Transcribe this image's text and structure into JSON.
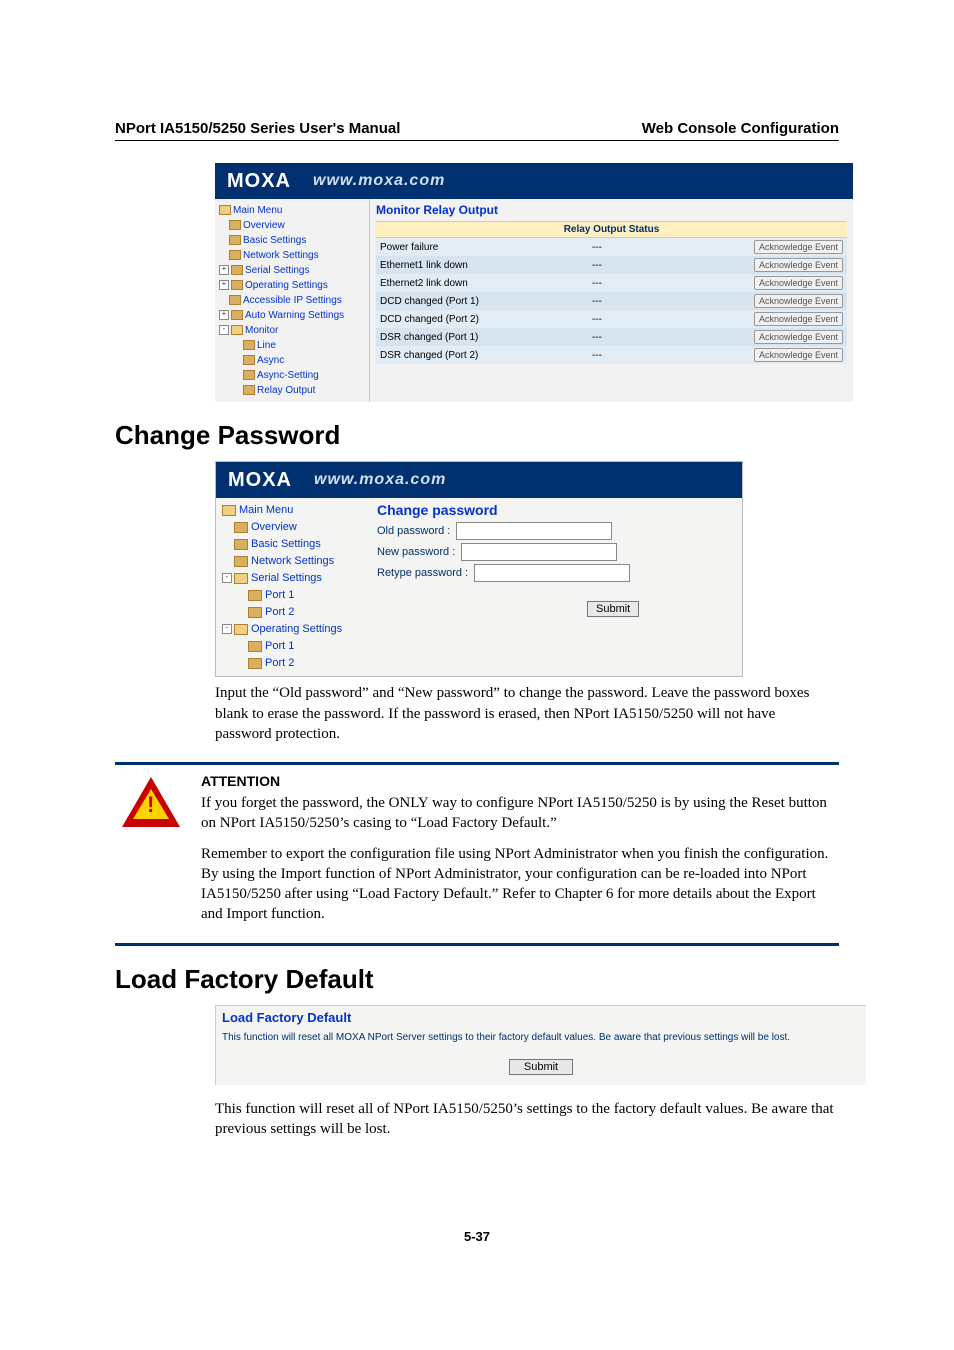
{
  "doc": {
    "header_left": "NPort IA5150/5250 Series User's Manual",
    "header_right": "Web Console Configuration",
    "page_num": "5-37"
  },
  "brand": {
    "logo": "MOXA",
    "url": "www.moxa.com"
  },
  "ss1": {
    "title": "Monitor Relay Output",
    "thead": "Relay Output Status",
    "tree": {
      "main": "Main Menu",
      "overview": "Overview",
      "basic": "Basic Settings",
      "network": "Network Settings",
      "serial": "Serial Settings",
      "operating": "Operating Settings",
      "accessible": "Accessible IP Settings",
      "autowarn": "Auto Warning Settings",
      "monitor": "Monitor",
      "line": "Line",
      "async": "Async",
      "asyncset": "Async-Setting",
      "relay": "Relay Output"
    },
    "rows": [
      {
        "event": "Power failure",
        "status": "---",
        "ack": "Acknowledge Event"
      },
      {
        "event": "Ethernet1 link down",
        "status": "---",
        "ack": "Acknowledge Event"
      },
      {
        "event": "Ethernet2 link down",
        "status": "---",
        "ack": "Acknowledge Event"
      },
      {
        "event": "DCD changed (Port 1)",
        "status": "---",
        "ack": "Acknowledge Event"
      },
      {
        "event": "DCD changed (Port 2)",
        "status": "---",
        "ack": "Acknowledge Event"
      },
      {
        "event": "DSR changed (Port 1)",
        "status": "---",
        "ack": "Acknowledge Event"
      },
      {
        "event": "DSR changed (Port 2)",
        "status": "---",
        "ack": "Acknowledge Event"
      }
    ]
  },
  "section_changepw": "Change Password",
  "ss2": {
    "title": "Change password",
    "tree": {
      "main": "Main Menu",
      "overview": "Overview",
      "basic": "Basic Settings",
      "network": "Network Settings",
      "serial": "Serial Settings",
      "port1": "Port 1",
      "port2": "Port 2",
      "operating": "Operating Settings",
      "oport1": "Port 1",
      "oport2": "Port 2"
    },
    "old_lbl": "Old password :",
    "new_lbl": "New password :",
    "re_lbl": "Retype password :",
    "submit": "Submit"
  },
  "para_changepw": "Input the “Old password” and “New password” to change the password. Leave the password boxes blank to erase the password. If the password is erased, then NPort IA5150/5250 will not have password protection.",
  "attention": {
    "label": "ATTENTION",
    "p1": "If you forget the password, the ONLY way to configure NPort IA5150/5250 is by using the Reset button on NPort IA5150/5250’s casing to “Load Factory Default.”",
    "p2": "Remember to export the configuration file using NPort Administrator when you finish the configuration. By using the Import function of NPort Administrator, your configuration can be re-loaded into NPort IA5150/5250 after using “Load Factory Default.” Refer to Chapter 6 for more details about the Export and Import function."
  },
  "section_load": "Load Factory Default",
  "ss3": {
    "title": "Load Factory Default",
    "warn": "This function will reset all MOXA NPort Server settings to their factory default values. Be aware that previous settings will be lost.",
    "submit": "Submit"
  },
  "para_load": "This function will reset all of NPort IA5150/5250’s settings to the factory default values. Be aware that previous settings will be lost."
}
